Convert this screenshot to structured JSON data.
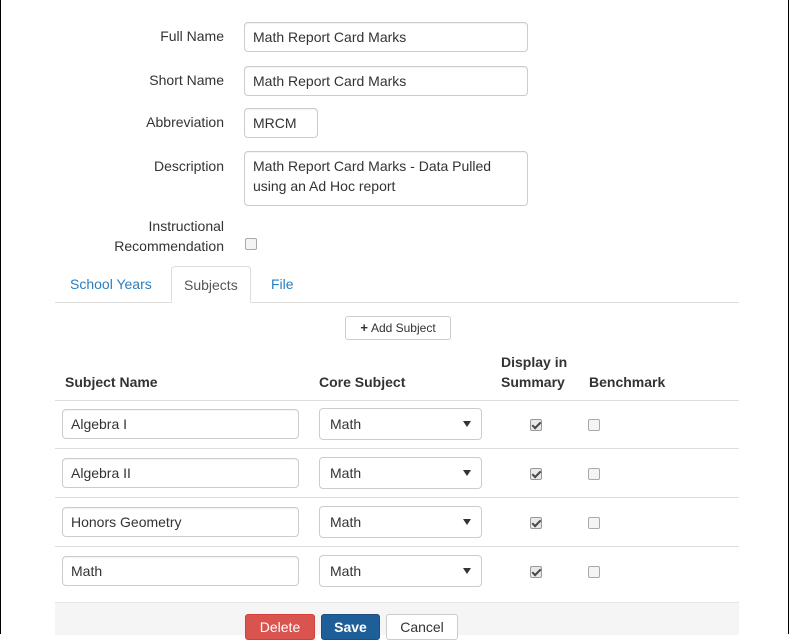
{
  "form": {
    "full_name": {
      "label": "Full Name",
      "value": "Math Report Card Marks"
    },
    "short_name": {
      "label": "Short Name",
      "value": "Math Report Card Marks"
    },
    "abbreviation": {
      "label": "Abbreviation",
      "value": "MRCM"
    },
    "description": {
      "label": "Description",
      "value": "Math Report Card Marks - Data Pulled using an Ad Hoc report"
    },
    "instructional_recommendation": {
      "label_line1": "Instructional",
      "label_line2": "Recommendation",
      "checked": false
    }
  },
  "tabs": [
    {
      "label": "School Years",
      "active": false
    },
    {
      "label": "Subjects",
      "active": true
    },
    {
      "label": "File",
      "active": false
    }
  ],
  "add_subject_label": "Add Subject",
  "table": {
    "headers": {
      "subject_name": "Subject Name",
      "core_subject": "Core Subject",
      "display_line1": "Display in",
      "display_line2": "Summary",
      "benchmark": "Benchmark"
    },
    "rows": [
      {
        "name": "Algebra I",
        "core": "Math",
        "display": true,
        "benchmark": false
      },
      {
        "name": "Algebra II",
        "core": "Math",
        "display": true,
        "benchmark": false
      },
      {
        "name": "Honors Geometry",
        "core": "Math",
        "display": true,
        "benchmark": false
      },
      {
        "name": "Math",
        "core": "Math",
        "display": true,
        "benchmark": false
      }
    ]
  },
  "footer": {
    "delete_label": "Delete",
    "save_label": "Save",
    "cancel_label": "Cancel"
  },
  "colors": {
    "link": "#2a7fc0",
    "danger": "#d9534f",
    "primary": "#1f5f99"
  }
}
